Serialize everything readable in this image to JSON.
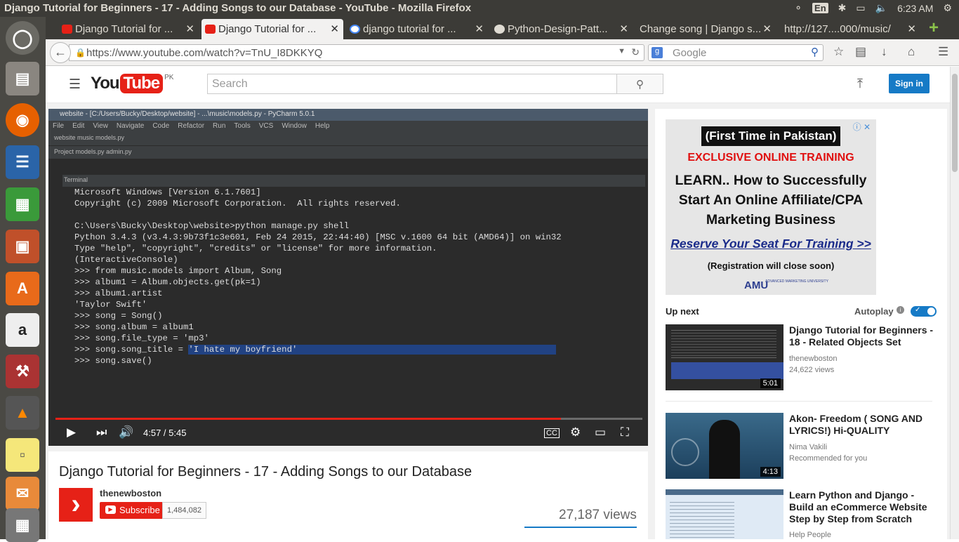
{
  "window_title": "Django Tutorial for Beginners - 17 - Adding Songs to our Database - YouTube - Mozilla Firefox",
  "tray": {
    "keyboard": "En",
    "time": "6:23 AM"
  },
  "tabs": [
    {
      "label": "Django Tutorial for ...",
      "active": false,
      "favicon": "youtube-favicon"
    },
    {
      "label": "Django Tutorial for ...",
      "active": true,
      "favicon": "youtube-favicon"
    },
    {
      "label": "django tutorial for ...",
      "active": false,
      "favicon": "google-favicon"
    },
    {
      "label": "Python-Design-Patt...",
      "active": false,
      "favicon": "github-favicon"
    },
    {
      "label": "Change song | Django s...",
      "active": false,
      "favicon": "none"
    },
    {
      "label": "http://127....000/music/",
      "active": false,
      "favicon": "none"
    }
  ],
  "nav": {
    "url": "https://www.youtube.com/watch?v=TnU_I8DKKYQ",
    "search_placeholder": "Google"
  },
  "yt": {
    "region": "PK",
    "logo_you": "You",
    "logo_tube": "Tube",
    "search_placeholder": "Search",
    "signin": "Sign in"
  },
  "video": {
    "pycharm_title": "website - [C:/Users/Bucky/Desktop/website] - ...\\music\\models.py - PyCharm 5.0.1",
    "pycharm_menu": [
      "File",
      "Edit",
      "View",
      "Navigate",
      "Code",
      "Refactor",
      "Run",
      "Tools",
      "VCS",
      "Window",
      "Help"
    ],
    "pycharm_tools": "website   music   models.py",
    "pycharm_tabs": "Project    models.py    admin.py",
    "pycharm_term_label": "Terminal",
    "terminal_lines": [
      "Microsoft Windows [Version 6.1.7601]",
      "Copyright (c) 2009 Microsoft Corporation.  All rights reserved.",
      "",
      "C:\\Users\\Bucky\\Desktop\\website>python manage.py shell",
      "Python 3.4.3 (v3.4.3:9b73f1c3e601, Feb 24 2015, 22:44:40) [MSC v.1600 64 bit (AMD64)] on win32",
      "Type \"help\", \"copyright\", \"credits\" or \"license\" for more information.",
      "(InteractiveConsole)",
      ">>> from music.models import Album, Song",
      ">>> album1 = Album.objects.get(pk=1)",
      ">>> album1.artist",
      "'Taylor Swift'",
      ">>> song = Song()",
      ">>> song.album = album1",
      ">>> song.file_type = 'mp3'",
      ">>> song.song_title = 'I hate my boyfriend'",
      ">>> song.save()"
    ],
    "time": "4:57 / 5:45",
    "progress": 0.8609,
    "title": "Django Tutorial for Beginners - 17 - Adding Songs to our Database",
    "channel": "thenewboston",
    "subscribe": "Subscribe",
    "subscribers": "1,484,082",
    "views": "27,187 views"
  },
  "ad": {
    "badge": "(First Time in Pakistan)",
    "headline": "EXCLUSIVE ONLINE TRAINING",
    "body": "LEARN.. How to Successfully Start An Online Affiliate/CPA Marketing Business",
    "cta": "Reserve Your Seat For Training >>",
    "note": "(Registration will close soon)",
    "logo": "AMU",
    "logo_sub": "ADVANCED MARKETING UNIVERSITY"
  },
  "sidebar": {
    "up_next": "Up next",
    "autoplay": "Autoplay",
    "related": [
      {
        "title": "Django Tutorial for Beginners - 18 - Related Objects Set",
        "channel": "thenewboston",
        "meta": "24,622 views",
        "duration": "5:01"
      },
      {
        "title": "Akon- Freedom ( SONG AND LYRICS!) Hi-QUALITY",
        "channel": "Nima Vakili",
        "meta": "Recommended for you",
        "duration": "4:13"
      },
      {
        "title": "Learn Python and Django - Build an eCommerce Website Step by Step from Scratch",
        "channel": "Help People",
        "meta": "",
        "duration": ""
      }
    ]
  }
}
